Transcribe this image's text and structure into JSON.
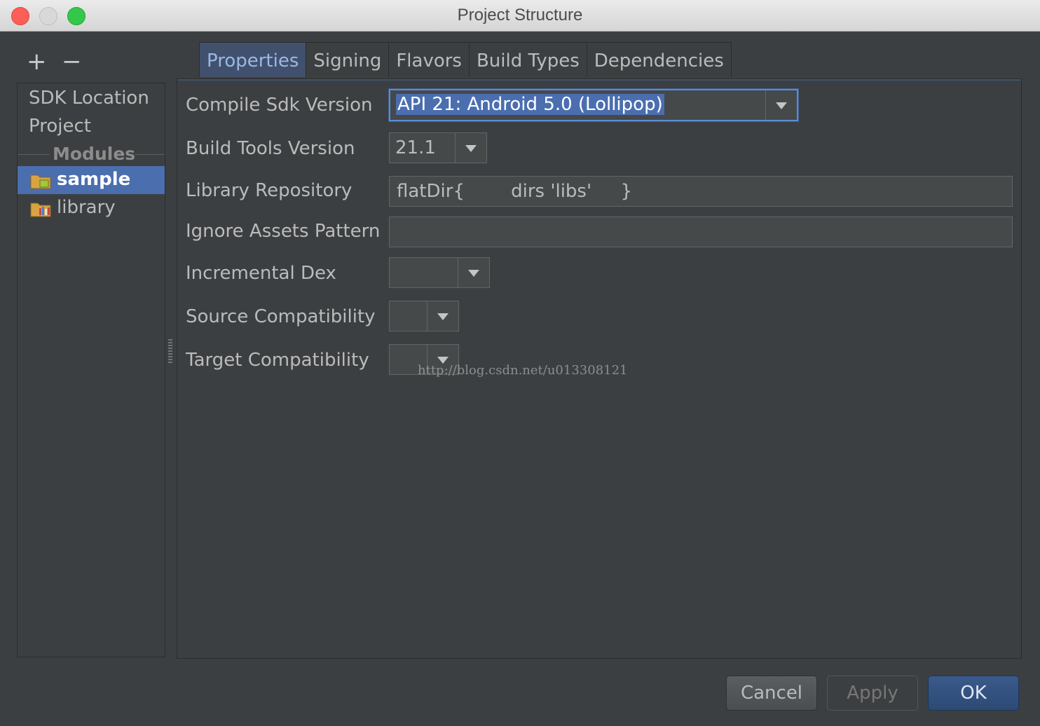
{
  "window": {
    "title": "Project Structure"
  },
  "toolbar": {
    "add_label": "+",
    "remove_label": "−"
  },
  "sidebar": {
    "items": [
      "SDK Location",
      "Project"
    ],
    "modules_header": "Modules",
    "modules": [
      {
        "label": "sample",
        "selected": true,
        "icon": "android-module-icon"
      },
      {
        "label": "library",
        "selected": false,
        "icon": "library-module-icon"
      }
    ]
  },
  "tabs": [
    {
      "label": "Properties",
      "active": true
    },
    {
      "label": "Signing",
      "active": false
    },
    {
      "label": "Flavors",
      "active": false
    },
    {
      "label": "Build Types",
      "active": false
    },
    {
      "label": "Dependencies",
      "active": false
    }
  ],
  "form": {
    "compile_sdk": {
      "label": "Compile Sdk Version",
      "value": "API 21: Android 5.0 (Lollipop)"
    },
    "build_tools": {
      "label": "Build Tools Version",
      "value": "21.1"
    },
    "library_repo": {
      "label": "Library Repository",
      "value": "flatDir{        dirs 'libs'     }"
    },
    "ignore_assets": {
      "label": "Ignore Assets Pattern",
      "value": ""
    },
    "incremental_dex": {
      "label": "Incremental Dex",
      "value": ""
    },
    "source_compat": {
      "label": "Source Compatibility",
      "value": ""
    },
    "target_compat": {
      "label": "Target Compatibility",
      "value": ""
    }
  },
  "watermark": "http://blog.csdn.net/u013308121",
  "buttons": {
    "cancel": "Cancel",
    "apply": "Apply",
    "ok": "OK"
  },
  "colors": {
    "background": "#3c3f41",
    "selection": "#4b6eaf",
    "active_tab": "#41516d",
    "focus_border": "#5b8cd6"
  }
}
